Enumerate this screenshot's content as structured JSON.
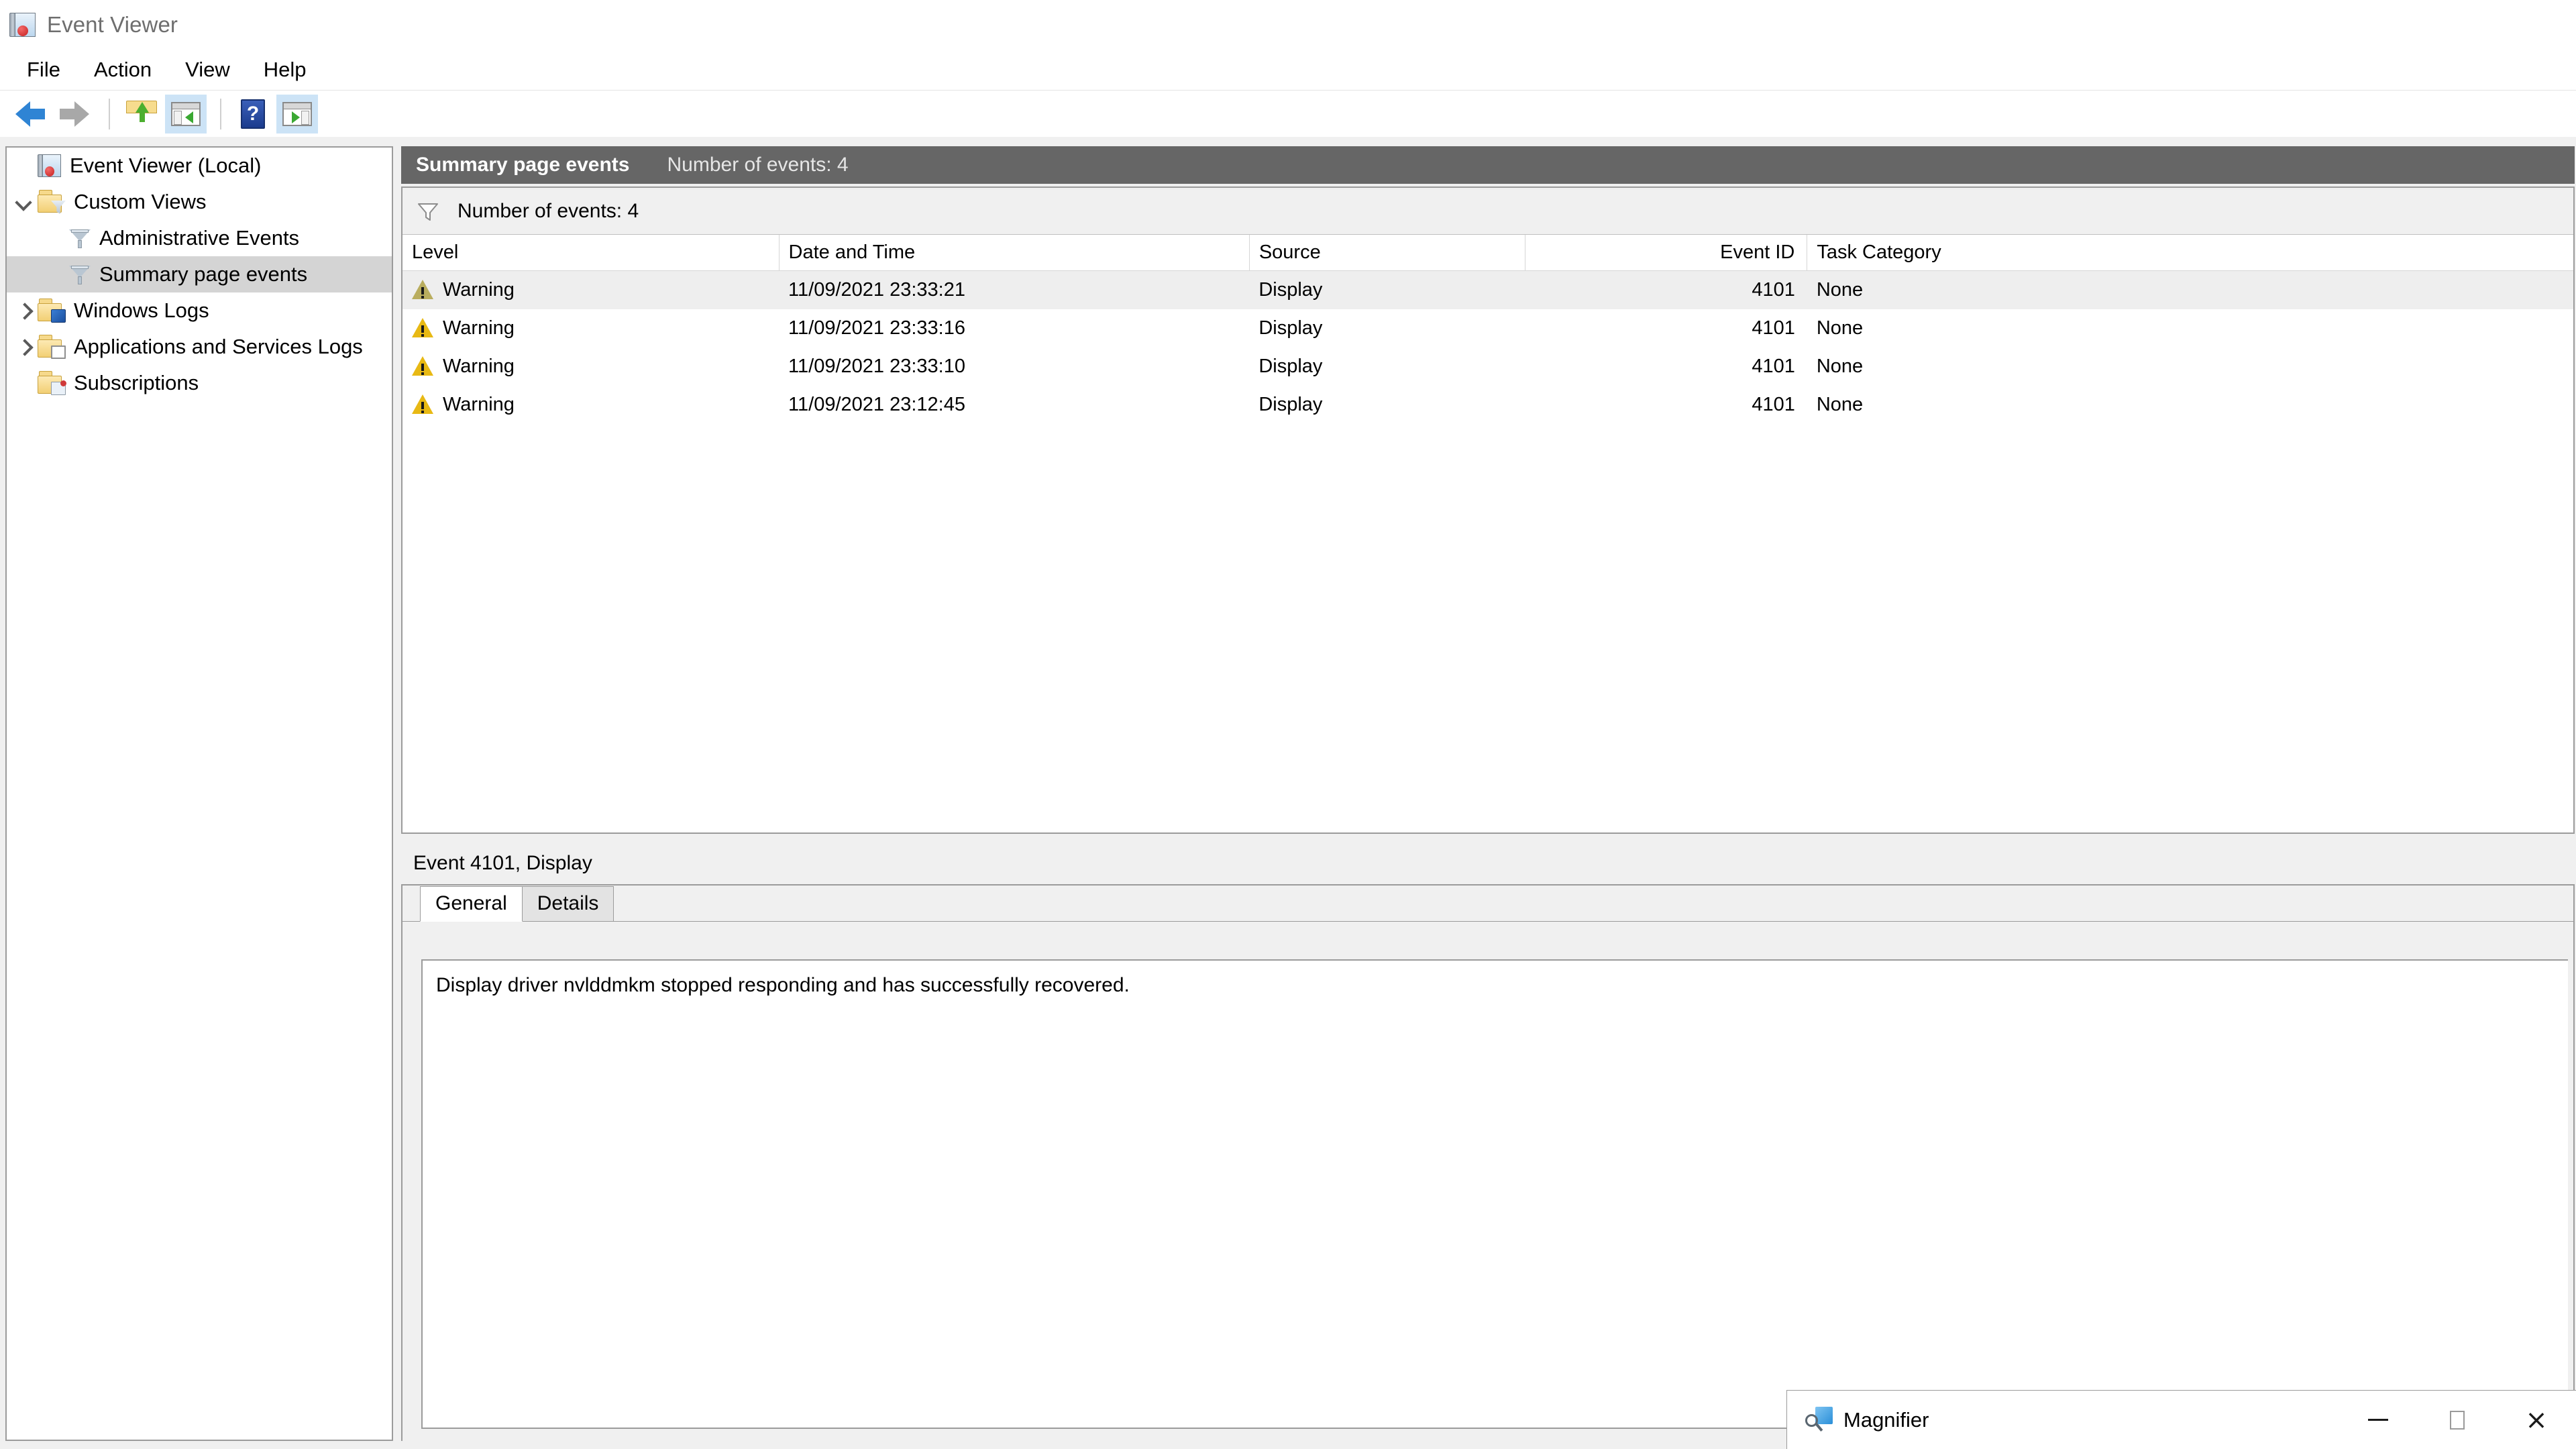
{
  "window": {
    "title": "Event Viewer",
    "icon": "event-viewer-icon"
  },
  "menu": {
    "items": [
      {
        "label": "File"
      },
      {
        "label": "Action"
      },
      {
        "label": "View"
      },
      {
        "label": "Help"
      }
    ]
  },
  "toolbar": {
    "buttons": [
      {
        "name": "back-button",
        "icon": "arrow-left-icon"
      },
      {
        "name": "forward-button",
        "icon": "arrow-right-icon"
      },
      {
        "name": "up-one-level-button",
        "icon": "folder-up-icon"
      },
      {
        "name": "show-hide-console-tree-button",
        "icon": "panel-left-icon"
      },
      {
        "name": "help-button",
        "icon": "help-icon"
      },
      {
        "name": "show-hide-action-pane-button",
        "icon": "panel-right-icon"
      }
    ]
  },
  "tree": {
    "items": [
      {
        "label": "Event Viewer (Local)",
        "icon": "event-viewer-icon",
        "indent": 1,
        "expander": "none",
        "selected": false
      },
      {
        "label": "Custom Views",
        "icon": "folder-filter-icon",
        "indent": 1,
        "expander": "down",
        "selected": false
      },
      {
        "label": "Administrative Events",
        "icon": "filter-funnel-icon",
        "indent": 3,
        "expander": "none",
        "selected": false
      },
      {
        "label": "Summary page events",
        "icon": "filter-funnel-icon",
        "indent": 3,
        "expander": "none",
        "selected": true
      },
      {
        "label": "Windows Logs",
        "icon": "folder-monitor-icon",
        "indent": 1,
        "expander": "right",
        "selected": false
      },
      {
        "label": "Applications and Services Logs",
        "icon": "folder-window-icon",
        "indent": 1,
        "expander": "right",
        "selected": false
      },
      {
        "label": "Subscriptions",
        "icon": "folder-subscriptions-icon",
        "indent": 2,
        "expander": "none",
        "selected": false
      }
    ]
  },
  "header": {
    "title": "Summary page events",
    "subtitle": "Number of events: 4"
  },
  "filter_bar": {
    "icon": "filter-funnel-outline-icon",
    "text": "Number of events: 4"
  },
  "events_table": {
    "columns": [
      {
        "label": "Level",
        "align": "left"
      },
      {
        "label": "Date and Time",
        "align": "left"
      },
      {
        "label": "Source",
        "align": "left"
      },
      {
        "label": "Event ID",
        "align": "right"
      },
      {
        "label": "Task Category",
        "align": "left"
      }
    ],
    "rows": [
      {
        "level": "Warning",
        "datetime": "11/09/2021 23:33:21",
        "source": "Display",
        "event_id": "4101",
        "task_category": "None",
        "selected": true
      },
      {
        "level": "Warning",
        "datetime": "11/09/2021 23:33:16",
        "source": "Display",
        "event_id": "4101",
        "task_category": "None",
        "selected": false
      },
      {
        "level": "Warning",
        "datetime": "11/09/2021 23:33:10",
        "source": "Display",
        "event_id": "4101",
        "task_category": "None",
        "selected": false
      },
      {
        "level": "Warning",
        "datetime": "11/09/2021 23:12:45",
        "source": "Display",
        "event_id": "4101",
        "task_category": "None",
        "selected": false
      }
    ]
  },
  "detail": {
    "header": "Event 4101, Display",
    "tabs": [
      {
        "label": "General",
        "active": true
      },
      {
        "label": "Details",
        "active": false
      }
    ],
    "body_text": "Display driver nvlddmkm stopped responding and has successfully recovered."
  },
  "magnifier": {
    "title": "Magnifier",
    "icon": "magnifier-icon",
    "controls": [
      {
        "name": "minimize-button",
        "glyph": "minimize"
      },
      {
        "name": "maximize-button",
        "glyph": "maximize"
      },
      {
        "name": "close-button",
        "glyph": "×"
      }
    ]
  },
  "colors": {
    "header_bar_bg": "#666666",
    "selection_row": "#eeeeee",
    "tree_selection": "#d4d4d4",
    "warning_yellow": "#e8b914",
    "toolbar_active": "#cce3f6"
  }
}
